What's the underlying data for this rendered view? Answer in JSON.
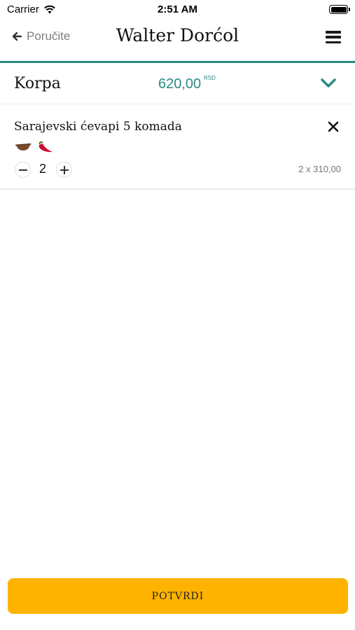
{
  "status_bar": {
    "carrier": "Carrier",
    "time": "2:51 AM"
  },
  "nav": {
    "back_label": "Poručite",
    "title": "Walter Dorćol"
  },
  "cart": {
    "title": "Korpa",
    "total": "620,00",
    "currency": "RSD"
  },
  "items": [
    {
      "name": "Sarajevski ćevapi 5 komada",
      "icons": [
        "bowl-icon",
        "chili-pepper-icon"
      ],
      "quantity": "2",
      "price_line": "2 x 310,00"
    }
  ],
  "confirm_label": "POTVRDI",
  "colors": {
    "accent": "#2a8a82",
    "button": "#fdb300"
  }
}
